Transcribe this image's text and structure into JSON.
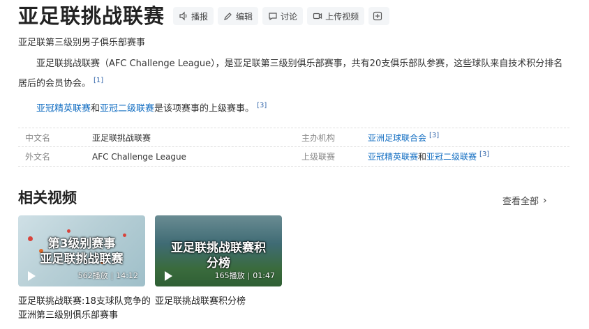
{
  "header": {
    "title": "亚足联挑战联赛",
    "actions": [
      "播报",
      "编辑",
      "讨论",
      "上传视频"
    ]
  },
  "subtitle": "亚足联第三级别男子俱乐部赛事",
  "summary": {
    "text": "亚足联挑战联赛（AFC Challenge League），是亚足联第三级别俱乐部赛事，共有20支俱乐部队参赛，这些球队来自技术积分排名居后的会员协会。",
    "ref": "[1]"
  },
  "para2": {
    "link1": "亚冠精英联赛",
    "and": "和",
    "link2": "亚冠二级联赛",
    "rest": "是该项赛事的上级赛事。",
    "ref": "[3]"
  },
  "info": {
    "rows": [
      {
        "k1": "中文名",
        "v1": "亚足联挑战联赛",
        "k2": "主办机构",
        "v2_link": "亚洲足球联合会",
        "v2_ref": "[3]"
      },
      {
        "k1": "外文名",
        "v1": "AFC Challenge League",
        "k2": "上级联赛",
        "v2_link_a": "亚冠精英联赛",
        "v2_and": "和",
        "v2_link_b": "亚冠二级联赛",
        "v2_ref": "[3]"
      }
    ]
  },
  "videos": {
    "heading": "相关视频",
    "see_all": "查看全部",
    "items": [
      {
        "overlay_line1": "第3级别赛事",
        "overlay_line2": "亚足联挑战联赛",
        "plays": "562播放",
        "duration": "14:12",
        "title": "亚足联挑战联赛:18支球队竞争的亚洲第三级别俱乐部赛事"
      },
      {
        "overlay_line1": "亚足联挑战联赛积",
        "overlay_line2": "分榜",
        "plays": "165播放",
        "duration": "01:47",
        "title": "亚足联挑战联赛积分榜"
      }
    ]
  }
}
